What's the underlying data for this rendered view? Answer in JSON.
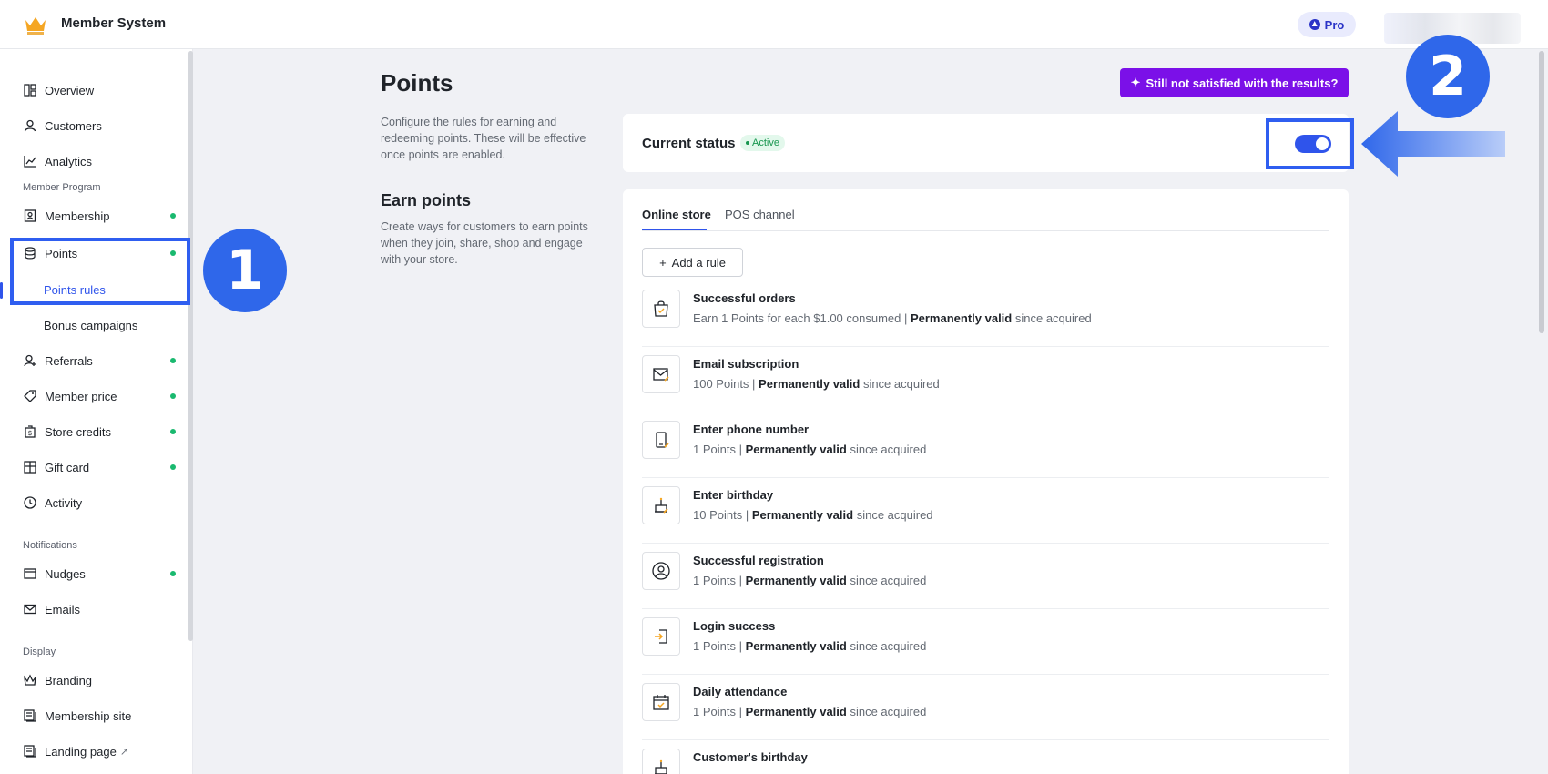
{
  "app": {
    "title": "Member System",
    "plan_badge": "Pro"
  },
  "sidebar": {
    "items": [
      {
        "label": "Overview",
        "icon": "dashboard-icon"
      },
      {
        "label": "Customers",
        "icon": "user-icon"
      },
      {
        "label": "Analytics",
        "icon": "chart-icon"
      }
    ],
    "section_member": "Member Program",
    "member_items": [
      {
        "label": "Membership",
        "icon": "badge-icon",
        "dot": true
      },
      {
        "label": "Points",
        "icon": "database-icon",
        "dot": true
      }
    ],
    "points_sub": [
      "Points rules",
      "Bonus campaigns"
    ],
    "member_items_2": [
      {
        "label": "Referrals",
        "icon": "user-add-icon",
        "dot": true
      },
      {
        "label": "Member price",
        "icon": "tag-icon",
        "dot": true
      },
      {
        "label": "Store credits",
        "icon": "wallet-icon",
        "dot": true
      },
      {
        "label": "Gift card",
        "icon": "gift-icon",
        "dot": true
      },
      {
        "label": "Activity",
        "icon": "clock-icon",
        "dot": false
      }
    ],
    "section_notifications": "Notifications",
    "notification_items": [
      {
        "label": "Nudges",
        "icon": "nudge-icon",
        "dot": true
      },
      {
        "label": "Emails",
        "icon": "mail-icon",
        "dot": false
      }
    ],
    "section_display": "Display",
    "display_items": [
      {
        "label": "Branding",
        "icon": "crown-icon"
      },
      {
        "label": "Membership site",
        "icon": "page-icon"
      },
      {
        "label": "Landing page",
        "icon": "page-icon"
      }
    ]
  },
  "annotations": {
    "step1": "1",
    "step2": "2"
  },
  "main": {
    "title": "Points",
    "description": "Configure the rules for earning and redeeming points. These will be effective once points are enabled.",
    "ai_button": "Still not satisfied with the results?",
    "status_label": "Current status",
    "status_value": "Active",
    "toggle_on": true,
    "earn_title": "Earn points",
    "earn_description": "Create ways for customers to earn points when they join, share, shop and engage with your store.",
    "tabs": [
      "Online store",
      "POS channel"
    ],
    "add_rule": "Add a rule",
    "rules": [
      {
        "title": "Successful orders",
        "prefix": "Earn 1 Points for each $1.00 consumed | ",
        "bold": "Permanently valid",
        "suffix": " since acquired",
        "icon": "shopping-bag-icon"
      },
      {
        "title": "Email subscription",
        "prefix": "100 Points | ",
        "bold": "Permanently valid",
        "suffix": " since acquired",
        "icon": "email-icon"
      },
      {
        "title": "Enter phone number",
        "prefix": "1 Points | ",
        "bold": "Permanently valid",
        "suffix": " since acquired",
        "icon": "phone-icon"
      },
      {
        "title": "Enter birthday",
        "prefix": "10 Points | ",
        "bold": "Permanently valid",
        "suffix": " since acquired",
        "icon": "cake-icon"
      },
      {
        "title": "Successful registration",
        "prefix": "1 Points | ",
        "bold": "Permanently valid",
        "suffix": " since acquired",
        "icon": "account-icon"
      },
      {
        "title": "Login success",
        "prefix": "1 Points | ",
        "bold": "Permanently valid",
        "suffix": " since acquired",
        "icon": "login-icon"
      },
      {
        "title": "Daily attendance",
        "prefix": "1 Points | ",
        "bold": "Permanently valid",
        "suffix": " since acquired",
        "icon": "calendar-icon"
      },
      {
        "title": "Customer's birthday",
        "prefix": "",
        "bold": "",
        "suffix": "",
        "icon": "cake-icon"
      }
    ]
  }
}
